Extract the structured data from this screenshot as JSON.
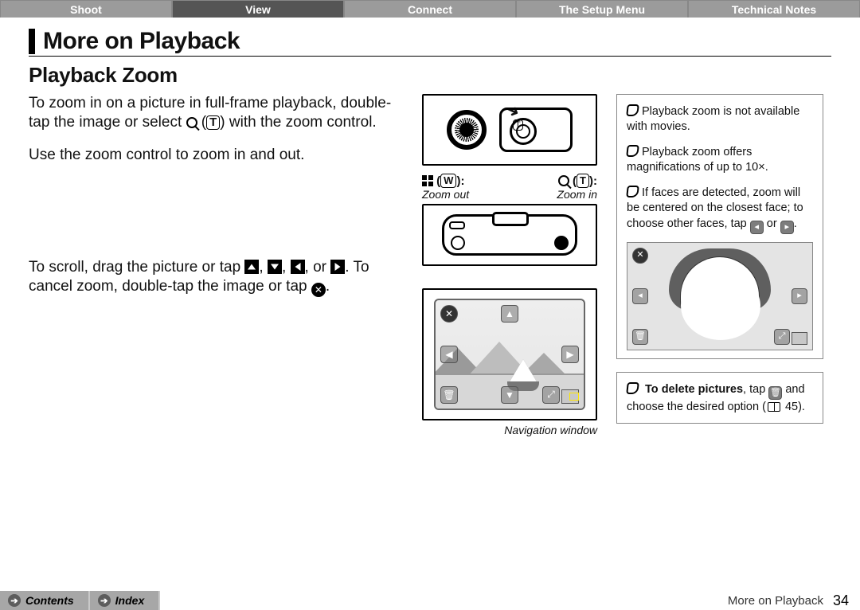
{
  "tabs": [
    "Shoot",
    "View",
    "Connect",
    "The Setup Menu",
    "Technical Notes"
  ],
  "active_tab_index": 1,
  "section_title": "More on Playback",
  "subsection_title": "Playback Zoom",
  "body": {
    "p1a": "To zoom in on a picture in full-frame playback, double-tap the image or select ",
    "p1b": " (",
    "p1c": ") with the zoom control.",
    "p2": "Use the zoom control to zoom in and out.",
    "p3a": "To scroll, drag the picture or tap ",
    "p3b": ". To cancel zoom, double-tap the image or tap ",
    "t_letter": "T",
    "comma": ", ",
    "or_word": "or ",
    "period": "."
  },
  "mid": {
    "w_label_sym_letter": "W",
    "w_label_colon": ":",
    "t_label_letter": "T",
    "zoom_out": "Zoom out",
    "zoom_in": "Zoom in",
    "nav_caption": "Navigation window"
  },
  "side": {
    "note1": "Playback zoom is not available with movies.",
    "note2": "Playback zoom offers magnifications of up to 10×.",
    "note3a": "If faces are detected, zoom will be centered on the closest face; to choose other faces, tap ",
    "note3_or": " or ",
    "note3b": ".",
    "note4a": "To delete pictures",
    "note4b": ", tap ",
    "note4c": " and choose the desired option (",
    "note4_page": "45",
    "note4d": ")."
  },
  "footer": {
    "contents": "Contents",
    "index": "Index",
    "location": "More on Playback",
    "page": "34"
  }
}
